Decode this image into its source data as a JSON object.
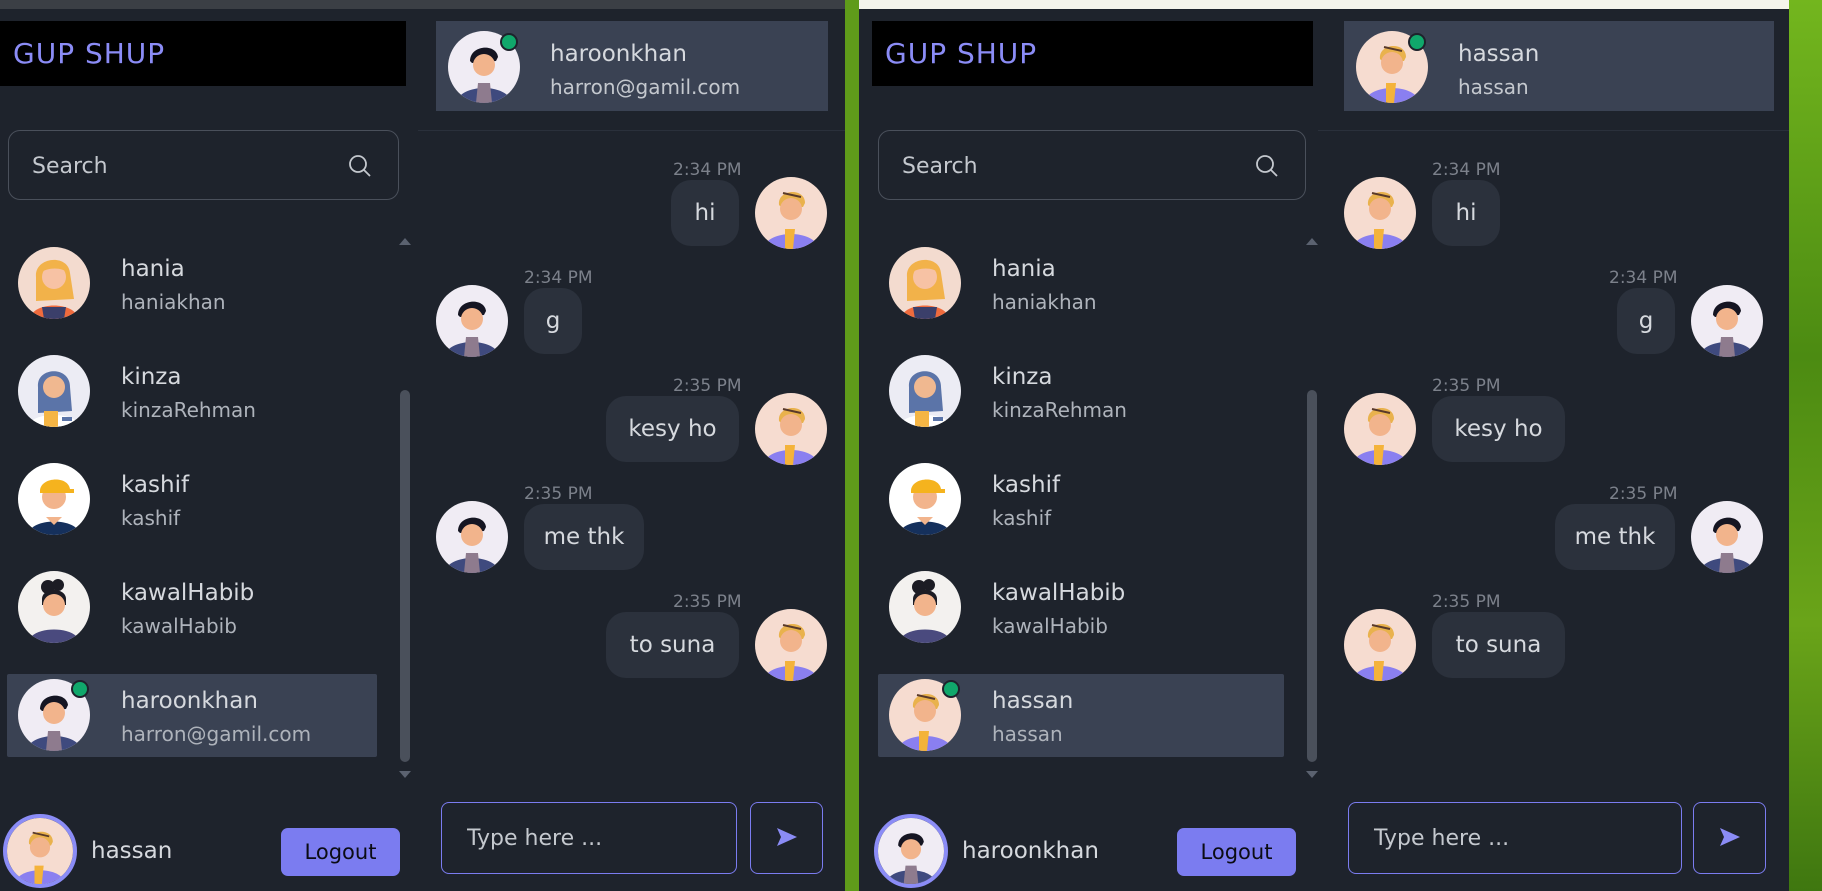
{
  "colors": {
    "accent": "#7b7cf0",
    "logo_text": "#8b8cf6",
    "online": "#10a86b",
    "active_item": "#3a4253"
  },
  "windows": [
    {
      "logo": "GUP SHUP",
      "search": {
        "placeholder": "Search"
      },
      "contacts": [
        {
          "name": "hania",
          "sub": "haniakhan",
          "avatar": "hania"
        },
        {
          "name": "kinza",
          "sub": "kinzaRehman",
          "avatar": "kinza"
        },
        {
          "name": "kashif",
          "sub": "kashif",
          "avatar": "kashif"
        },
        {
          "name": "kawalHabib",
          "sub": "kawalHabib",
          "avatar": "kawal"
        },
        {
          "name": "haroonkhan",
          "sub": "harron@gamil.com",
          "avatar": "haroon",
          "online": true,
          "active": true
        }
      ],
      "current_user": {
        "name": "hassan",
        "avatar": "hassan"
      },
      "logout_label": "Logout",
      "chat_header": {
        "name": "haroonkhan",
        "sub": "harron@gamil.com",
        "avatar": "haroon",
        "online": true
      },
      "messages": [
        {
          "time": "2:34 PM",
          "text": "hi",
          "from_me": true,
          "avatar": "hassan"
        },
        {
          "time": "2:34 PM",
          "text": "g",
          "from_me": false,
          "avatar": "haroon"
        },
        {
          "time": "2:35 PM",
          "text": "kesy ho",
          "from_me": true,
          "avatar": "hassan"
        },
        {
          "time": "2:35 PM",
          "text": "me thk",
          "from_me": false,
          "avatar": "haroon"
        },
        {
          "time": "2:35 PM",
          "text": "to suna",
          "from_me": true,
          "avatar": "hassan"
        }
      ],
      "composer": {
        "placeholder": "Type here ...",
        "send_icon": "send-icon"
      }
    },
    {
      "logo": "GUP SHUP",
      "search": {
        "placeholder": "Search"
      },
      "contacts": [
        {
          "name": "hania",
          "sub": "haniakhan",
          "avatar": "hania"
        },
        {
          "name": "kinza",
          "sub": "kinzaRehman",
          "avatar": "kinza"
        },
        {
          "name": "kashif",
          "sub": "kashif",
          "avatar": "kashif"
        },
        {
          "name": "kawalHabib",
          "sub": "kawalHabib",
          "avatar": "kawal"
        },
        {
          "name": "hassan",
          "sub": "hassan",
          "avatar": "hassan",
          "online": true,
          "active": true
        }
      ],
      "current_user": {
        "name": "haroonkhan",
        "avatar": "haroon"
      },
      "logout_label": "Logout",
      "chat_header": {
        "name": "hassan",
        "sub": "hassan",
        "avatar": "hassan",
        "online": true
      },
      "messages": [
        {
          "time": "2:34 PM",
          "text": "hi",
          "from_me": false,
          "avatar": "hassan"
        },
        {
          "time": "2:34 PM",
          "text": "g",
          "from_me": true,
          "avatar": "haroon"
        },
        {
          "time": "2:35 PM",
          "text": "kesy ho",
          "from_me": false,
          "avatar": "hassan"
        },
        {
          "time": "2:35 PM",
          "text": "me thk",
          "from_me": true,
          "avatar": "haroon"
        },
        {
          "time": "2:35 PM",
          "text": "to suna",
          "from_me": false,
          "avatar": "hassan"
        }
      ],
      "composer": {
        "placeholder": "Type here ...",
        "send_icon": "send-icon"
      }
    }
  ]
}
